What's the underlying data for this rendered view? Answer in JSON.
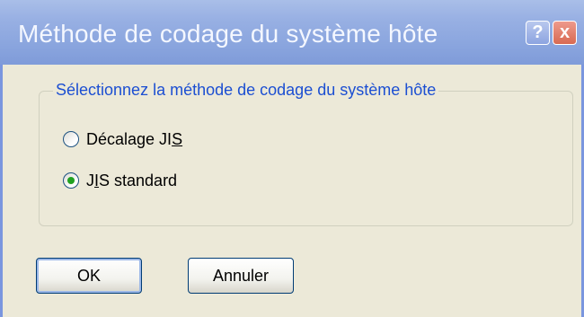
{
  "window": {
    "title": "Méthode de codage du système hôte",
    "help_label": "?",
    "close_label": "x"
  },
  "group": {
    "label": "Sélectionnez la méthode de codage du système hôte"
  },
  "options": [
    {
      "label_prefix": "Décalage JI",
      "accel": "S",
      "label_suffix": "",
      "selected": false
    },
    {
      "label_prefix": "J",
      "accel": "I",
      "label_suffix": "S standard",
      "selected": true
    }
  ],
  "buttons": {
    "ok_label": "OK",
    "cancel_label": "Annuler"
  }
}
